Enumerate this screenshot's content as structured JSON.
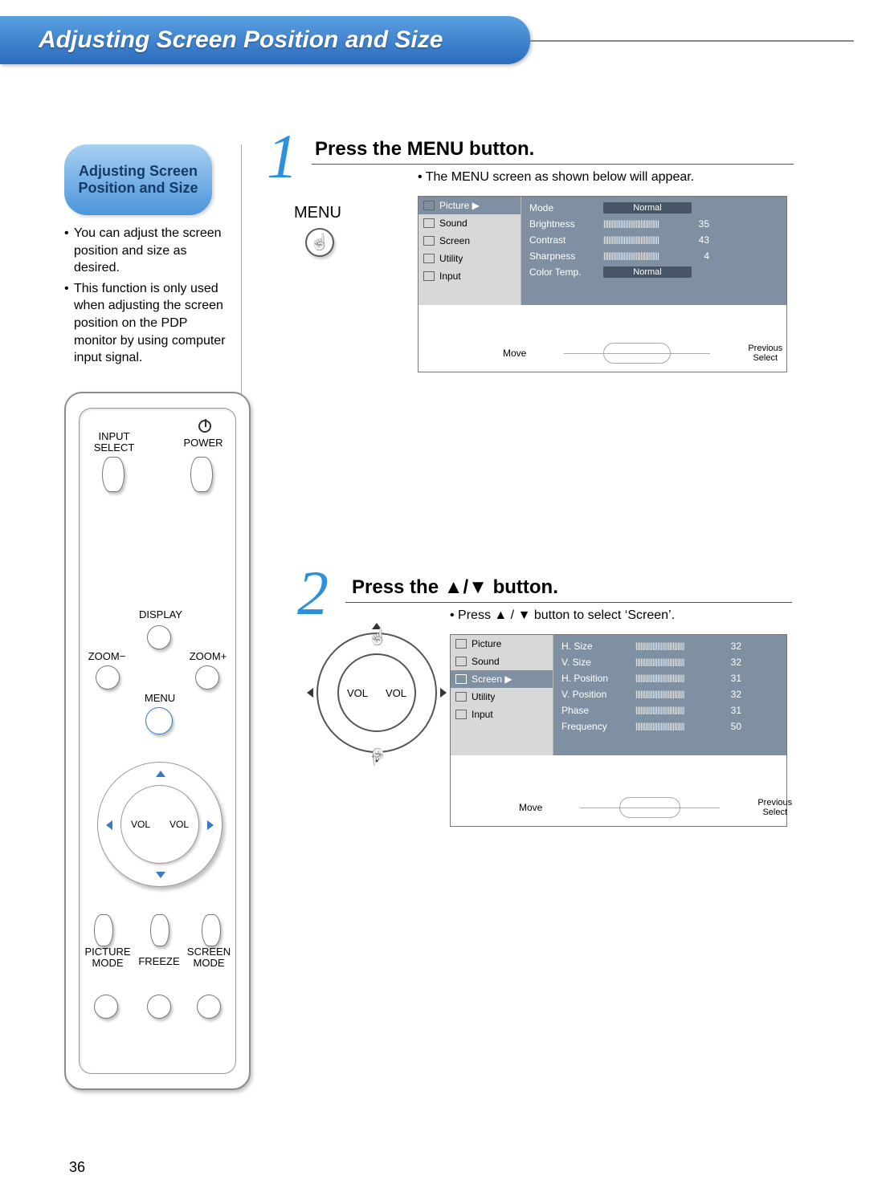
{
  "page": {
    "title": "Adjusting Screen Position and Size",
    "number": "36"
  },
  "sidebar": {
    "pill": "Adjusting Screen Position and Size",
    "bullets": [
      "You can adjust the screen position and size as desired.",
      "This function is only used when adjusting the screen position on the PDP monitor by using computer input signal."
    ]
  },
  "remote": {
    "input_select": "INPUT SELECT",
    "power": "POWER",
    "display": "DISPLAY",
    "zoom_minus": "ZOOM−",
    "zoom_plus": "ZOOM+",
    "menu": "MENU",
    "vol_left": "VOL",
    "vol_right": "VOL",
    "picture_mode": "PICTURE MODE",
    "freeze": "FREEZE",
    "screen_mode": "SCREEN MODE"
  },
  "step1": {
    "num": "1",
    "heading": "Press the MENU button.",
    "note": "• The MENU screen as shown below will appear.",
    "menu_label": "MENU",
    "osd": {
      "left": [
        "Picture ▶",
        "Sound",
        "Screen",
        "Utility",
        "Input"
      ],
      "right": [
        {
          "label": "Mode",
          "value": "Normal",
          "box": true
        },
        {
          "label": "Brightness",
          "value": "|||||||||||||||||||||||||||||||||",
          "num": "35"
        },
        {
          "label": "Contrast",
          "value": "|||||||||||||||||||||||||||||||||",
          "num": "43"
        },
        {
          "label": "Sharpness",
          "value": "|||||||||||||||||||||||||||||||||",
          "num": "4"
        },
        {
          "label": "Color Temp.",
          "value": "Normal",
          "box": true
        }
      ],
      "foot_move": "Move",
      "foot_prev": "Previous",
      "foot_sel": "Select"
    }
  },
  "step2": {
    "num": "2",
    "heading": "Press the ▲/▼ button.",
    "note": "• Press  ▲ / ▼  button to select ‘Screen’.",
    "vol_left": "VOL",
    "vol_right": "VOL",
    "osd": {
      "left": [
        "Picture",
        "Sound",
        "Screen  ▶",
        "Utility",
        "Input"
      ],
      "right": [
        {
          "label": "H. Size",
          "value": "|||||||||||||||||||||||||||||",
          "num": "32"
        },
        {
          "label": "V. Size",
          "value": "|||||||||||||||||||||||||||||",
          "num": "32"
        },
        {
          "label": "H. Position",
          "value": "|||||||||||||||||||||||||||||",
          "num": "31"
        },
        {
          "label": "V. Position",
          "value": "|||||||||||||||||||||||||||||",
          "num": "32"
        },
        {
          "label": "Phase",
          "value": "|||||||||||||||||||||||||||||",
          "num": "31"
        },
        {
          "label": "Frequency",
          "value": "|||||||||||||||||||||||||||||",
          "num": "50"
        }
      ],
      "foot_move": "Move",
      "foot_prev": "Previous",
      "foot_sel": "Select"
    }
  }
}
